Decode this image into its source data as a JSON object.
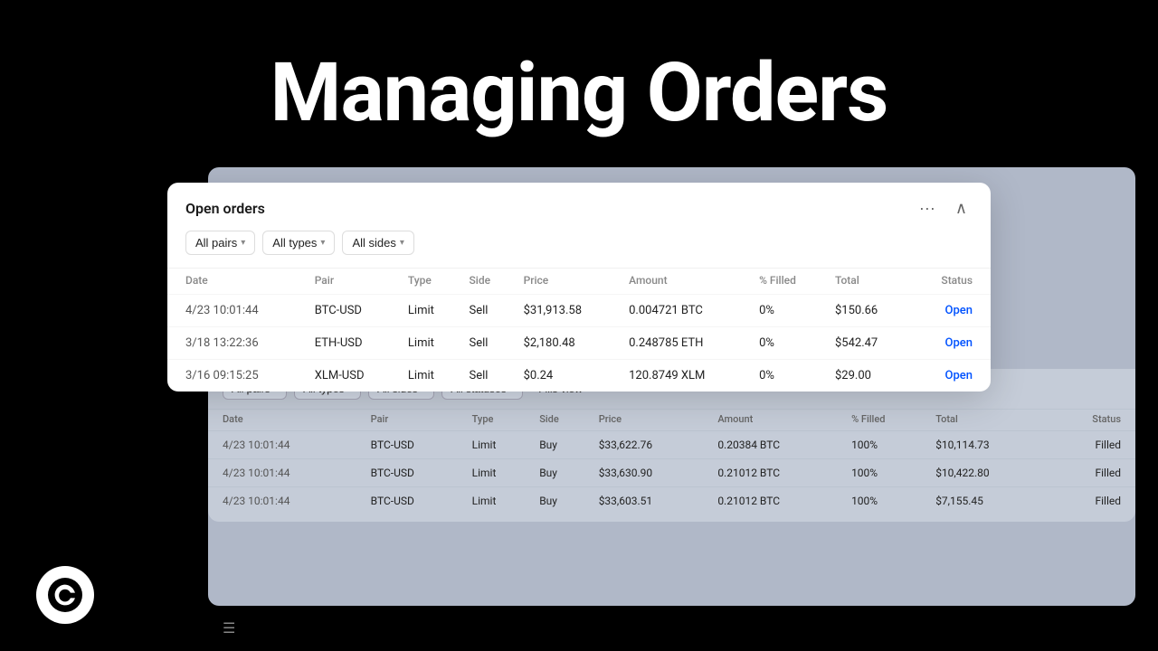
{
  "page": {
    "title": "Managing Orders"
  },
  "modal": {
    "title": "Open orders",
    "more_icon": "···",
    "collapse_icon": "∧",
    "filters": [
      {
        "label": "All pairs",
        "id": "filter-pairs"
      },
      {
        "label": "All types",
        "id": "filter-types"
      },
      {
        "label": "All sides",
        "id": "filter-sides"
      }
    ],
    "table": {
      "columns": [
        "Date",
        "Pair",
        "Type",
        "Side",
        "Price",
        "Amount",
        "% Filled",
        "Total",
        "Status"
      ],
      "rows": [
        {
          "date": "4/23 10:01:44",
          "pair": "BTC-USD",
          "type": "Limit",
          "side": "Sell",
          "price": "$31,913.58",
          "amount": "0.004721 BTC",
          "pct_filled": "0%",
          "total": "$150.66",
          "status": "Open"
        },
        {
          "date": "3/18 13:22:36",
          "pair": "ETH-USD",
          "type": "Limit",
          "side": "Sell",
          "price": "$2,180.48",
          "amount": "0.248785 ETH",
          "pct_filled": "0%",
          "total": "$542.47",
          "status": "Open"
        },
        {
          "date": "3/16 09:15:25",
          "pair": "XLM-USD",
          "type": "Limit",
          "side": "Sell",
          "price": "$0.24",
          "amount": "120.8749 XLM",
          "pct_filled": "0%",
          "total": "$29.00",
          "status": "Open"
        }
      ]
    }
  },
  "fills_panel": {
    "filters": [
      {
        "label": "All pairs"
      },
      {
        "label": "All types"
      },
      {
        "label": "All sides"
      },
      {
        "label": "All statuses"
      }
    ],
    "fills_view_label": "Fills view",
    "table": {
      "columns": [
        "Date",
        "Pair",
        "Type",
        "Side",
        "Price",
        "Amount",
        "% Filled",
        "Total",
        "Status"
      ],
      "rows": [
        {
          "date": "4/23 10:01:44",
          "pair": "BTC-USD",
          "type": "Limit",
          "side": "Buy",
          "price": "$33,622.76",
          "amount": "0.20384 BTC",
          "pct_filled": "100%",
          "total": "$10,114.73",
          "status": "Filled"
        },
        {
          "date": "4/23 10:01:44",
          "pair": "BTC-USD",
          "type": "Limit",
          "side": "Buy",
          "price": "$33,630.90",
          "amount": "0.21012 BTC",
          "pct_filled": "100%",
          "total": "$10,422.80",
          "status": "Filled"
        },
        {
          "date": "4/23 10:01:44",
          "pair": "BTC-USD",
          "type": "Limit",
          "side": "Buy",
          "price": "$33,603.51",
          "amount": "0.21012 BTC",
          "pct_filled": "100%",
          "total": "$7,155.45",
          "status": "Filled"
        }
      ]
    }
  }
}
